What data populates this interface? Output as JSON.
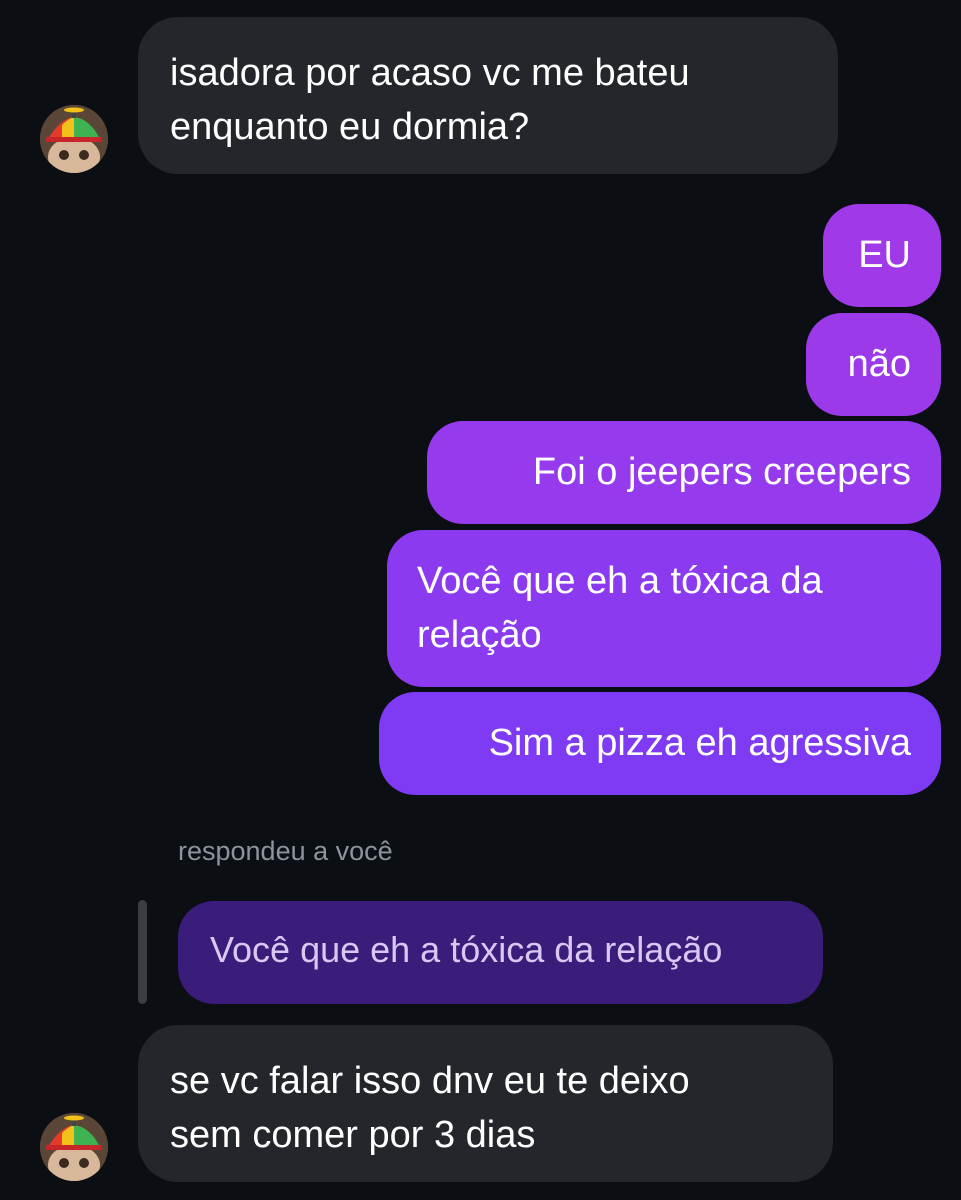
{
  "conversation": {
    "messages": [
      {
        "direction": "incoming",
        "text": "isadora por acaso vc me bateu\nenquanto eu dormia?"
      },
      {
        "direction": "outgoing",
        "text": "EU"
      },
      {
        "direction": "outgoing",
        "text": "não"
      },
      {
        "direction": "outgoing",
        "text": "Foi o jeepers creepers"
      },
      {
        "direction": "outgoing",
        "text": "Você que eh a tóxica da\nrelação"
      },
      {
        "direction": "outgoing",
        "text": "Sim a pizza eh agressiva"
      },
      {
        "direction": "incoming",
        "text": "se vc falar isso dnv eu te deixo\nsem comer por 3 dias"
      }
    ],
    "reply": {
      "label": "respondeu a você",
      "quoted_text": "Você que eh a tóxica da relação"
    }
  },
  "contact": {
    "avatar_icon": "avatar-with-propeller-cap"
  },
  "colors": {
    "background": "#0b0f14",
    "incoming_bubble": "#23272b",
    "outgoing_gradient_top": "#a03ae8",
    "outgoing_gradient_bottom": "#7b3af5",
    "quoted_bubble": "#3a1c7a",
    "reply_label": "#8e949b"
  }
}
